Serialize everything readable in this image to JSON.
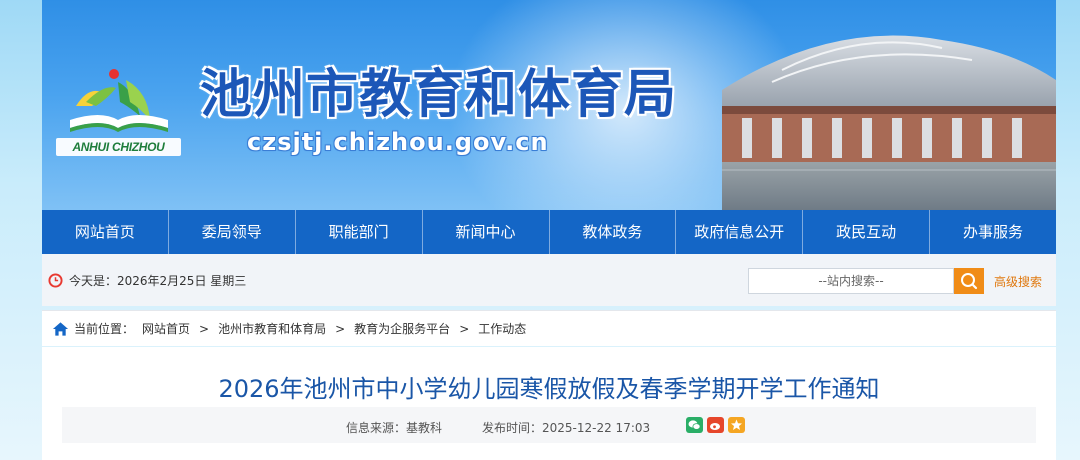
{
  "header": {
    "logo_text": "ANHUI CHIZHOU",
    "title": "池州市教育和体育局",
    "domain": "czsjtj.chizhou.gov.cn"
  },
  "nav": {
    "items": [
      "网站首页",
      "委局领导",
      "职能部门",
      "新闻中心",
      "教体政务",
      "政府信息公开",
      "政民互动",
      "办事服务"
    ]
  },
  "infobar": {
    "date_text": "今天是：2026年2月25日 星期三",
    "search_placeholder": "--站内搜索--",
    "advanced_search": "高级搜索"
  },
  "breadcrumb": {
    "prefix": "当前位置：",
    "items": [
      "网站首页",
      "池州市教育和体育局",
      "教育为企服务平台",
      "工作动态"
    ],
    "separator": ">"
  },
  "article": {
    "title": "2026年池州市中小学幼儿园寒假放假及春季学期开学工作通知",
    "source": "信息来源：基教科",
    "publish_time": "发布时间：2025-12-22 17:03"
  },
  "colors": {
    "nav_bg": "#1466c6",
    "title_blue": "#1c57b8",
    "accent_orange": "#f08c17",
    "article_title": "#1a56a7"
  },
  "icons": {
    "clock": "clock-icon",
    "search": "search-icon",
    "home": "home-icon",
    "share": [
      "wechat-icon",
      "weibo-icon",
      "qzone-icon"
    ]
  }
}
